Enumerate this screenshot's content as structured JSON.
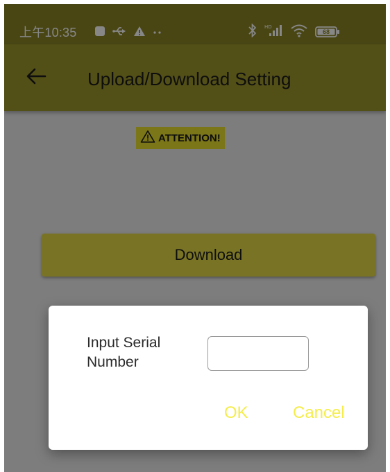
{
  "status_bar": {
    "time": "上午10:35",
    "icons": [
      "notification-square-icon",
      "usb-icon",
      "warning-icon",
      "more-dots-icon",
      "bluetooth-icon",
      "hd-signal-icon",
      "wifi-icon",
      "battery-icon"
    ],
    "battery_level": "68"
  },
  "app_bar": {
    "title": "Upload/Download Setting",
    "back_icon": "arrow-left-icon"
  },
  "content": {
    "attention_label": "ATTENTION!",
    "download_label": "Download"
  },
  "dialog": {
    "label": "Input Serial Number",
    "input_value": "",
    "ok_label": "OK",
    "cancel_label": "Cancel"
  },
  "colors": {
    "app_bar": "#9c952d",
    "accent": "#e5dc47",
    "attention_bg": "#e9df2e",
    "dialog_button_text": "#f5ed4a"
  }
}
